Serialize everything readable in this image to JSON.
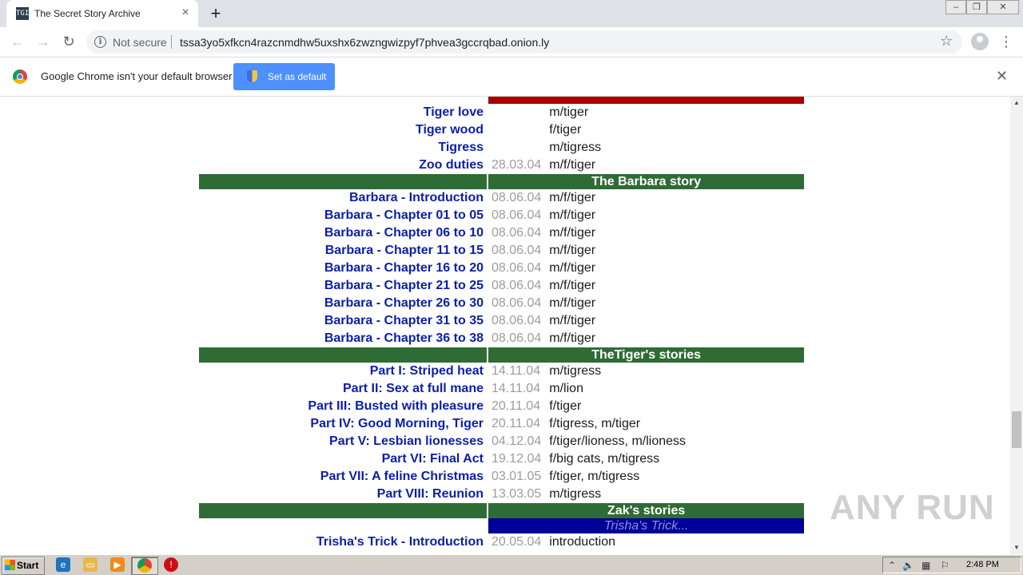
{
  "browser": {
    "tab_title": "The Secret Story Archive",
    "tab_favicon": "TGI",
    "security_label": "Not secure",
    "url": "tssa3yo5xfkcn4razcnmdhw5uxshx6zwzngwizpyf7phvea3gccrqbad.onion.ly",
    "infobar_text": "Google Chrome isn't your default browser",
    "infobar_button": "Set as default"
  },
  "sections": [
    {
      "header": "",
      "header_color": "#a80000",
      "rows": [
        {
          "title": "Tiger love",
          "date": "",
          "category": "m/tiger"
        },
        {
          "title": "Tiger wood",
          "date": "",
          "category": "f/tiger"
        },
        {
          "title": "Tigress",
          "date": "",
          "category": "m/tigress"
        },
        {
          "title": "Zoo duties",
          "date": "28.03.04",
          "category": "m/f/tiger"
        }
      ]
    },
    {
      "header": "The Barbara story",
      "header_color": "#2f6b35",
      "rows": [
        {
          "title": "Barbara - Introduction",
          "date": "08.06.04",
          "category": "m/f/tiger"
        },
        {
          "title": "Barbara - Chapter 01 to 05",
          "date": "08.06.04",
          "category": "m/f/tiger"
        },
        {
          "title": "Barbara - Chapter 06 to 10",
          "date": "08.06.04",
          "category": "m/f/tiger"
        },
        {
          "title": "Barbara - Chapter 11 to 15",
          "date": "08.06.04",
          "category": "m/f/tiger"
        },
        {
          "title": "Barbara - Chapter 16 to 20",
          "date": "08.06.04",
          "category": "m/f/tiger"
        },
        {
          "title": "Barbara - Chapter 21 to 25",
          "date": "08.06.04",
          "category": "m/f/tiger"
        },
        {
          "title": "Barbara - Chapter 26 to 30",
          "date": "08.06.04",
          "category": "m/f/tiger"
        },
        {
          "title": "Barbara - Chapter 31 to 35",
          "date": "08.06.04",
          "category": "m/f/tiger"
        },
        {
          "title": "Barbara - Chapter 36 to 38",
          "date": "08.06.04",
          "category": "m/f/tiger"
        }
      ]
    },
    {
      "header": "TheTiger's stories",
      "header_color": "#2f6b35",
      "rows": [
        {
          "title": "Part I: Striped heat",
          "date": "14.11.04",
          "category": "m/tigress"
        },
        {
          "title": "Part II: Sex at full mane",
          "date": "14.11.04",
          "category": "m/lion"
        },
        {
          "title": "Part III: Busted with pleasure",
          "date": "20.11.04",
          "category": "f/tiger"
        },
        {
          "title": "Part IV: Good Morning, Tiger",
          "date": "20.11.04",
          "category": "f/tigress, m/tiger"
        },
        {
          "title": "Part V: Lesbian lionesses",
          "date": "04.12.04",
          "category": "f/tiger/lioness, m/lioness"
        },
        {
          "title": "Part VI: Final Act",
          "date": "19.12.04",
          "category": "f/big cats, m/tigress"
        },
        {
          "title": "Part VII: A feline Christmas",
          "date": "03.01.05",
          "category": "f/tiger, m/tigress"
        },
        {
          "title": "Part VIII: Reunion",
          "date": "13.03.05",
          "category": "m/tigress"
        }
      ]
    },
    {
      "header": "Zak's stories",
      "header_color": "#2f6b35",
      "subheader": "Trisha's Trick...",
      "rows": [
        {
          "title": "Trisha's Trick - Introduction",
          "date": "20.05.04",
          "category": "introduction"
        }
      ]
    }
  ],
  "watermark": "ANY RUN",
  "taskbar": {
    "start_label": "Start",
    "clock": "2:48 PM"
  },
  "icons": [
    "tab-favicon",
    "close-icon",
    "plus-icon",
    "back-icon",
    "forward-icon",
    "reload-icon",
    "info-icon",
    "star-icon",
    "avatar",
    "menu-icon",
    "chrome-logo-icon",
    "shield-icon",
    "windows-logo-icon",
    "ie-icon",
    "explorer-icon",
    "media-player-icon",
    "chrome-icon",
    "opera-icon",
    "flag-icon",
    "speaker-icon",
    "network-icon"
  ]
}
